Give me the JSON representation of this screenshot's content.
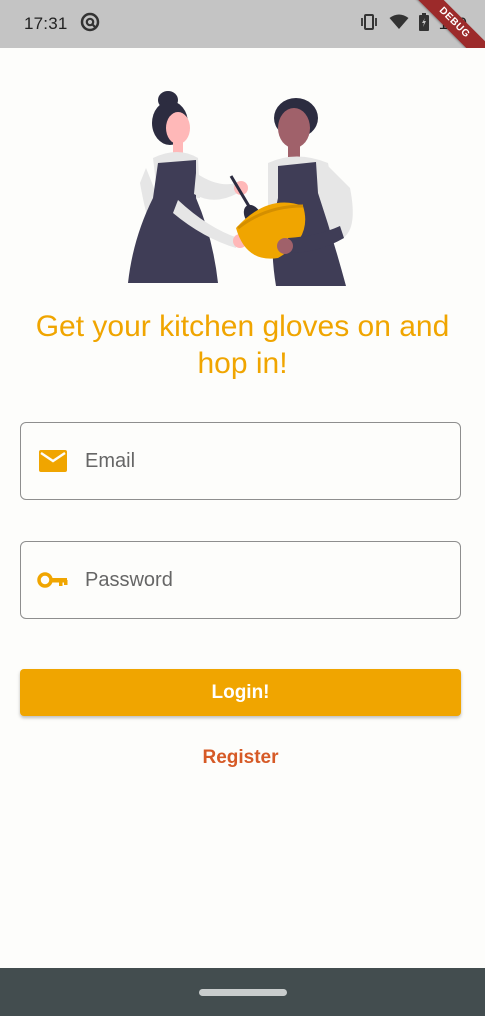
{
  "status_bar": {
    "time": "17:31",
    "battery_text": "100",
    "debug_label": "DEBUG"
  },
  "illustration": {
    "icon": "chefs-cooking-illustration"
  },
  "headline": "Get your kitchen gloves on and hop in!",
  "form": {
    "email": {
      "placeholder": "Email",
      "value": "",
      "icon": "email-icon"
    },
    "password": {
      "placeholder": "Password",
      "value": "",
      "icon": "key-icon"
    },
    "login_label": "Login!",
    "register_label": "Register"
  },
  "colors": {
    "accent": "#f0a500",
    "link": "#d65a26",
    "status_bar": "#c4c4c4",
    "nav_bar": "#434d4f"
  }
}
